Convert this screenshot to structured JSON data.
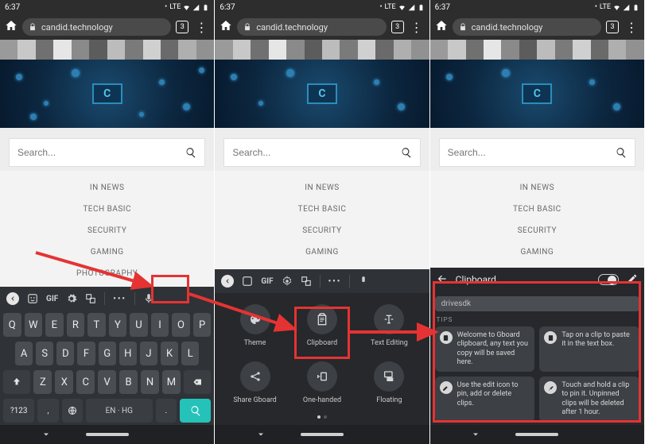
{
  "status": {
    "time": "6:37",
    "lte": "LTE"
  },
  "address": {
    "url": "candid.technology",
    "tab_count": "3"
  },
  "search": {
    "placeholder": "Search..."
  },
  "nav": {
    "items": [
      "IN NEWS",
      "TECH BASIC",
      "SECURITY",
      "GAMING",
      "PHOTOGRAPHY"
    ]
  },
  "keyboard": {
    "toolbar_gif": "GIF",
    "row1": [
      "Q",
      "W",
      "E",
      "R",
      "T",
      "Y",
      "U",
      "I",
      "O",
      "P"
    ],
    "row2": [
      "A",
      "S",
      "D",
      "F",
      "G",
      "H",
      "J",
      "K",
      "L"
    ],
    "row3": [
      "Z",
      "X",
      "C",
      "V",
      "B",
      "N",
      "M"
    ],
    "numkey": "?123",
    "space_label": "EN · HG"
  },
  "gridmenu": {
    "tiles": [
      {
        "id": "theme",
        "label": "Theme"
      },
      {
        "id": "clipboard",
        "label": "Clipboard"
      },
      {
        "id": "textediting",
        "label": "Text Editing"
      },
      {
        "id": "share",
        "label": "Share Gboard"
      },
      {
        "id": "onehanded",
        "label": "One-handed"
      },
      {
        "id": "floating",
        "label": "Floating"
      }
    ]
  },
  "clipboard": {
    "title": "Clipboard",
    "prefill": "drivesdk",
    "tips_label": "TIPS",
    "tips": [
      "Welcome to Gboard clipboard, any text you copy will be saved here.",
      "Tap on a clip to paste it in the text box.",
      "Use the edit icon to pin, add or delete clips.",
      "Touch and hold a clip to pin it. Unpinned clips will be deleted after 1 hour."
    ]
  },
  "banner_center": "C"
}
